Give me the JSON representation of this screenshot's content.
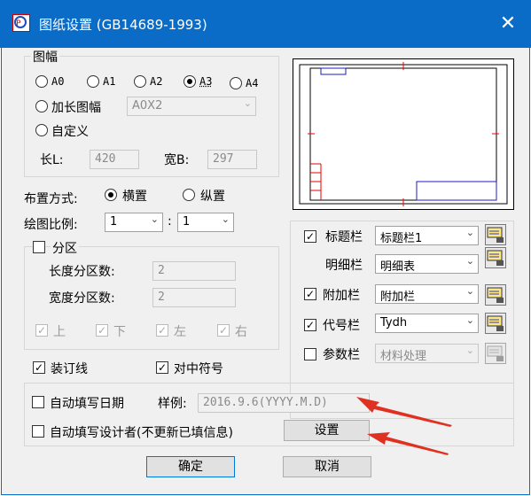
{
  "window": {
    "title": "图纸设置 (GB14689-1993)",
    "close": "✕"
  },
  "paper": {
    "group_label": "图幅",
    "sizes": [
      {
        "label": "A0",
        "selected": false
      },
      {
        "label": "A1",
        "selected": false
      },
      {
        "label": "A2",
        "selected": false
      },
      {
        "label": "A3",
        "selected": true
      },
      {
        "label": "A4",
        "selected": false
      }
    ],
    "extended_label": "加长图幅",
    "extended_value": "A0X2",
    "custom_label": "自定义",
    "length_label": "长L:",
    "length_value": "420",
    "width_label": "宽B:",
    "width_value": "297"
  },
  "layout": {
    "label": "布置方式:",
    "horizontal": "横置",
    "vertical": "纵置",
    "selected": "横置"
  },
  "scale": {
    "label": "绘图比例:",
    "left": "1",
    "sep": ":",
    "right": "1"
  },
  "zones": {
    "label": "分区",
    "length_label": "长度分区数:",
    "length_value": "2",
    "width_label": "宽度分区数:",
    "width_value": "2",
    "sides": [
      "上",
      "下",
      "左",
      "右"
    ]
  },
  "binding": {
    "label": "装订线",
    "checked": true
  },
  "centering": {
    "label": "对中符号",
    "checked": true
  },
  "blocks": [
    {
      "label": "标题栏",
      "checked": true,
      "has_check": true,
      "value": "标题栏1",
      "enabled": true
    },
    {
      "label": "明细栏",
      "checked": false,
      "has_check": false,
      "value": "明细表",
      "enabled": true
    },
    {
      "label": "附加栏",
      "checked": true,
      "has_check": true,
      "value": "附加栏",
      "enabled": true
    },
    {
      "label": "代号栏",
      "checked": true,
      "has_check": true,
      "value": "Tydh",
      "enabled": true
    },
    {
      "label": "参数栏",
      "checked": false,
      "has_check": true,
      "value": "材料处理",
      "enabled": false
    }
  ],
  "autofill": {
    "date_label": "自动填写日期",
    "sample_label": "样例:",
    "sample_value": "2016.9.6(YYYY.M.D)",
    "designer_label": "自动填写设计者(不更新已填信息)",
    "settings_button": "设置"
  },
  "buttons": {
    "ok": "确定",
    "cancel": "取消"
  },
  "colors": {
    "titlebar": "#0a6cc7",
    "annotation_arrow": "#e03020",
    "frame_blue": "#1c1cc0"
  }
}
